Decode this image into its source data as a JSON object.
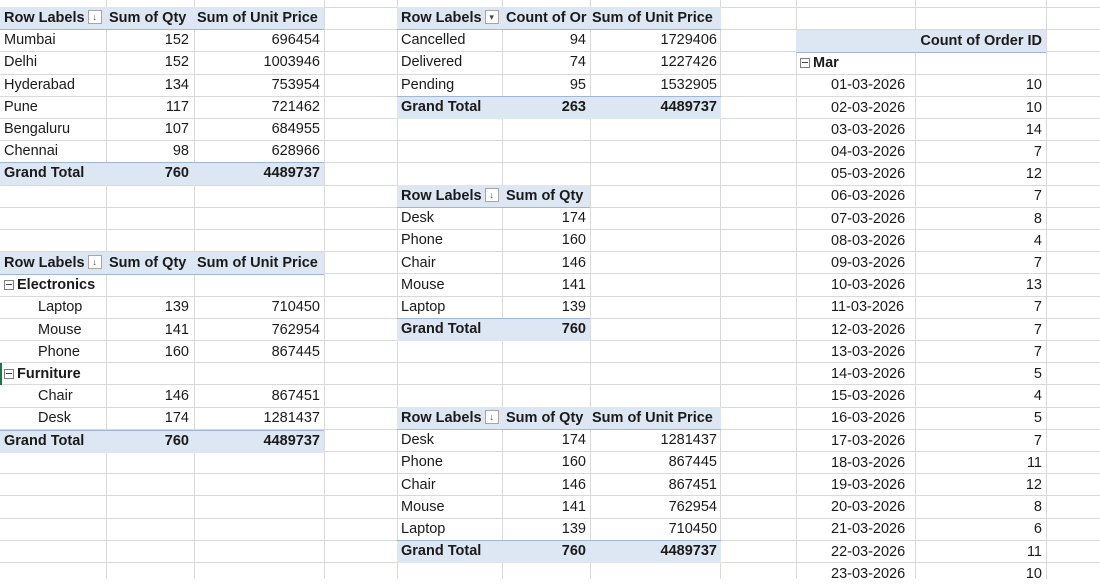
{
  "pivot_city": {
    "headers": [
      "Row Labels",
      "Sum of Qty",
      "Sum of Unit Price"
    ],
    "rows": [
      [
        "Mumbai",
        "152",
        "696454"
      ],
      [
        "Delhi",
        "152",
        "1003946"
      ],
      [
        "Hyderabad",
        "134",
        "753954"
      ],
      [
        "Pune",
        "117",
        "721462"
      ],
      [
        "Bengaluru",
        "107",
        "684955"
      ],
      [
        "Chennai",
        "98",
        "628966"
      ]
    ],
    "total": [
      "Grand Total",
      "760",
      "4489737"
    ]
  },
  "pivot_category": {
    "headers": [
      "Row Labels",
      "Sum of Qty",
      "Sum of Unit Price"
    ],
    "groups": [
      {
        "name": "Electronics",
        "rows": [
          [
            "Laptop",
            "139",
            "710450"
          ],
          [
            "Mouse",
            "141",
            "762954"
          ],
          [
            "Phone",
            "160",
            "867445"
          ]
        ]
      },
      {
        "name": "Furniture",
        "rows": [
          [
            "Chair",
            "146",
            "867451"
          ],
          [
            "Desk",
            "174",
            "1281437"
          ]
        ]
      }
    ],
    "total": [
      "Grand Total",
      "760",
      "4489737"
    ]
  },
  "pivot_status": {
    "headers": [
      "Row Labels",
      "Count of Or",
      "Sum of Unit Price"
    ],
    "rows": [
      [
        "Cancelled",
        "94",
        "1729406"
      ],
      [
        "Delivered",
        "74",
        "1227426"
      ],
      [
        "Pending",
        "95",
        "1532905"
      ]
    ],
    "total": [
      "Grand Total",
      "263",
      "4489737"
    ]
  },
  "pivot_product_qty": {
    "headers": [
      "Row Labels",
      "Sum of Qty"
    ],
    "rows": [
      [
        "Desk",
        "174"
      ],
      [
        "Phone",
        "160"
      ],
      [
        "Chair",
        "146"
      ],
      [
        "Mouse",
        "141"
      ],
      [
        "Laptop",
        "139"
      ]
    ],
    "total": [
      "Grand Total",
      "760"
    ]
  },
  "pivot_product_price": {
    "headers": [
      "Row Labels",
      "Sum of Qty",
      "Sum of Unit Price"
    ],
    "rows": [
      [
        "Desk",
        "174",
        "1281437"
      ],
      [
        "Phone",
        "160",
        "867445"
      ],
      [
        "Chair",
        "146",
        "867451"
      ],
      [
        "Mouse",
        "141",
        "762954"
      ],
      [
        "Laptop",
        "139",
        "710450"
      ]
    ],
    "total": [
      "Grand Total",
      "760",
      "4489737"
    ]
  },
  "pivot_date": {
    "header": "Count of Order ID",
    "group": "Mar",
    "rows": [
      [
        "01-03-2026",
        "10"
      ],
      [
        "02-03-2026",
        "10"
      ],
      [
        "03-03-2026",
        "14"
      ],
      [
        "04-03-2026",
        "7"
      ],
      [
        "05-03-2026",
        "12"
      ],
      [
        "06-03-2026",
        "7"
      ],
      [
        "07-03-2026",
        "8"
      ],
      [
        "08-03-2026",
        "4"
      ],
      [
        "09-03-2026",
        "7"
      ],
      [
        "10-03-2026",
        "13"
      ],
      [
        "11-03-2026",
        "7"
      ],
      [
        "12-03-2026",
        "7"
      ],
      [
        "13-03-2026",
        "7"
      ],
      [
        "14-03-2026",
        "5"
      ],
      [
        "15-03-2026",
        "4"
      ],
      [
        "16-03-2026",
        "5"
      ],
      [
        "17-03-2026",
        "7"
      ],
      [
        "18-03-2026",
        "11"
      ],
      [
        "19-03-2026",
        "12"
      ],
      [
        "20-03-2026",
        "8"
      ],
      [
        "21-03-2026",
        "6"
      ],
      [
        "22-03-2026",
        "11"
      ],
      [
        "23-03-2026",
        "10"
      ]
    ]
  },
  "icons": {
    "sort_desc": "↓",
    "filter_dropdown": "▾"
  }
}
